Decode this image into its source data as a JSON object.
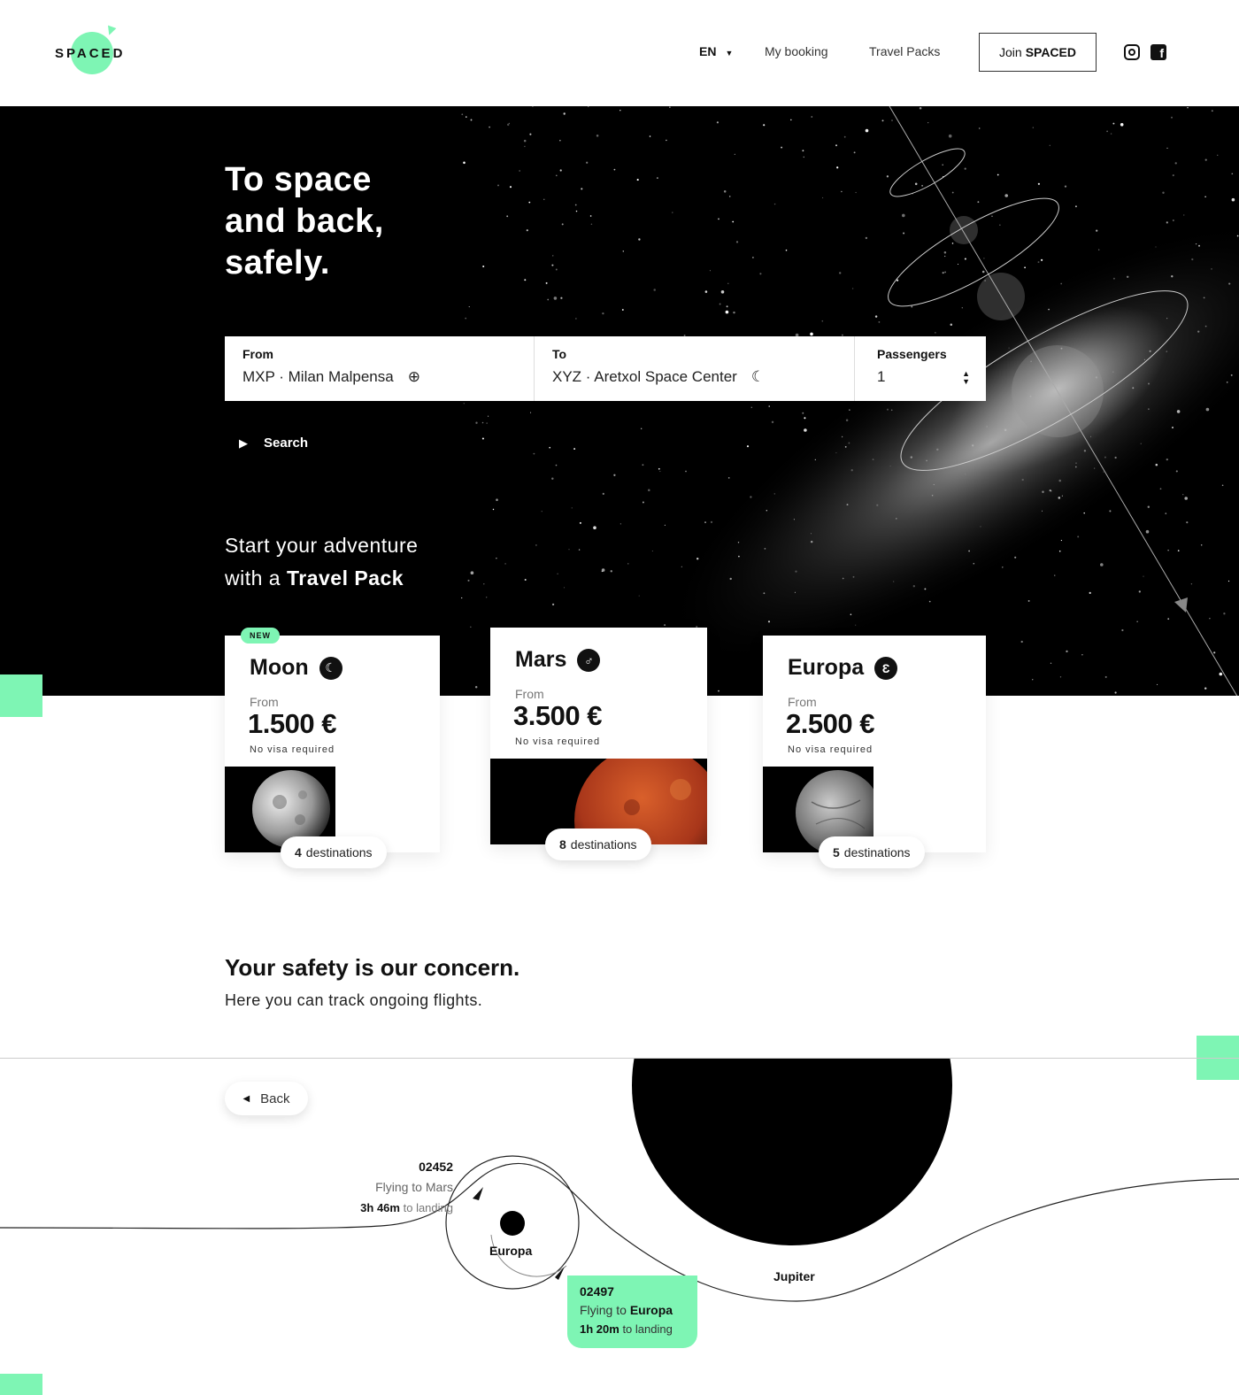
{
  "header": {
    "logo": "SPACED",
    "lang": "EN",
    "nav": [
      "My booking",
      "Travel Packs"
    ],
    "join_prefix": "Join",
    "join_brand": "SPACED"
  },
  "hero": {
    "title": "To space\nand back,\nsafely.",
    "search": {
      "from_label": "From",
      "from_value": "MXP · Milan Malpensa",
      "to_label": "To",
      "to_value": "XYZ · Aretxol Space Center",
      "pass_label": "Passengers",
      "pass_value": "1",
      "button": "Search"
    },
    "tagline_line1": "Start your adventure",
    "tagline_line2_prefix": "with a",
    "tagline_line2_bold": "Travel Pack"
  },
  "packs": [
    {
      "badge": "NEW",
      "name": "Moon",
      "symbol": "☾",
      "from": "From",
      "price": "1.500 €",
      "visa": "No visa required",
      "dest_count": "4",
      "dest_label": "destinations"
    },
    {
      "name": "Mars",
      "symbol": "♂",
      "from": "From",
      "price": "3.500 €",
      "visa": "No visa required",
      "dest_count": "8",
      "dest_label": "destinations"
    },
    {
      "name": "Europa",
      "symbol": "Ɛ",
      "from": "From",
      "price": "2.500 €",
      "visa": "No visa required",
      "dest_count": "5",
      "dest_label": "destinations"
    }
  ],
  "safety": {
    "title": "Your safety is our concern.",
    "subtitle": "Here you can track ongoing flights.",
    "back": "Back",
    "flights": [
      {
        "id": "02452",
        "line_prefix": "Flying to",
        "dest": "Mars",
        "time": "3h 46m",
        "time_suffix": "to landing"
      },
      {
        "id": "02497",
        "line_prefix": "Flying to",
        "dest": "Europa",
        "time": "1h 20m",
        "time_suffix": "to landing"
      }
    ],
    "bodies": [
      "Europa",
      "Jupiter"
    ]
  },
  "colors": {
    "accent": "#7ef5b4",
    "dark": "#000000"
  }
}
